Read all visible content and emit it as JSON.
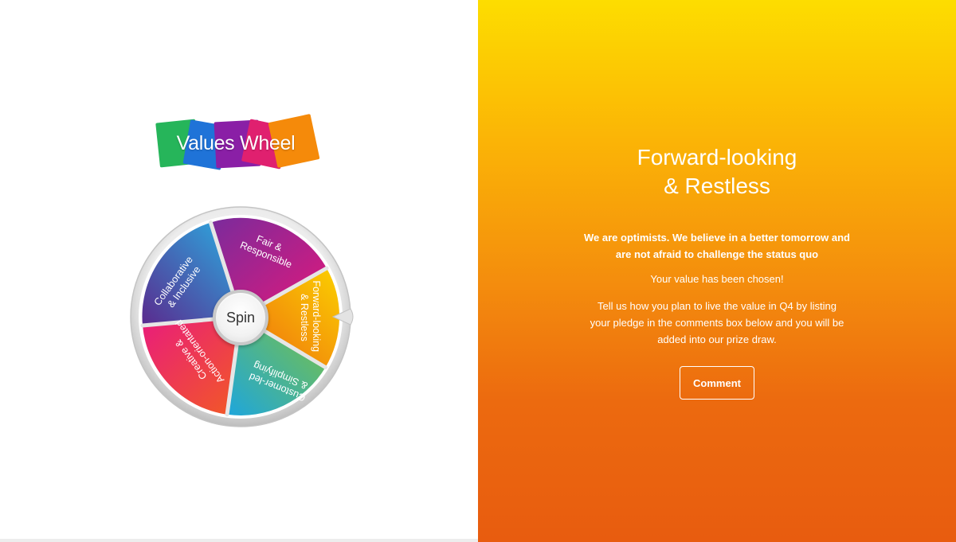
{
  "logo": {
    "text": "Values Wheel",
    "tile_colors": [
      "#2fb457",
      "#1e88e5",
      "#8e24aa",
      "#e91e63",
      "#f57c00"
    ]
  },
  "wheel": {
    "spin_label": "Spin",
    "segments": [
      {
        "label_lines": [
          "Fair &",
          "Responsible"
        ],
        "color_start": "#8e2b9e",
        "color_end": "#e3187a"
      },
      {
        "label_lines": [
          "Forward-looking",
          "& Restless"
        ],
        "color_start": "#fbc400",
        "color_end": "#ee6a10"
      },
      {
        "label_lines": [
          "Customer-led",
          "& Simplifying"
        ],
        "color_start": "#1fa8d8",
        "color_end": "#6cc04a"
      },
      {
        "label_lines": [
          "Creative &",
          "Action-orientated"
        ],
        "color_start": "#e4207e",
        "color_end": "#f05a28"
      },
      {
        "label_lines": [
          "Collaborative",
          "& Inclusive"
        ],
        "color_start": "#2aa6e0",
        "color_end": "#5b2c8e"
      }
    ]
  },
  "value": {
    "title_line1": "Forward-looking",
    "title_line2": "& Restless",
    "description": "We are optimists. We believe in a better tomorrow and are not afraid to challenge the status quo",
    "status": "Your value has been chosen!",
    "instructions": "Tell us how you plan to live the value in Q4 by listing your pledge in the comments box below and you will be added into our prize draw.",
    "comment_label": "Comment"
  },
  "colors": {
    "gradient_top": "#fddd00",
    "gradient_bottom": "#e85c0f"
  }
}
